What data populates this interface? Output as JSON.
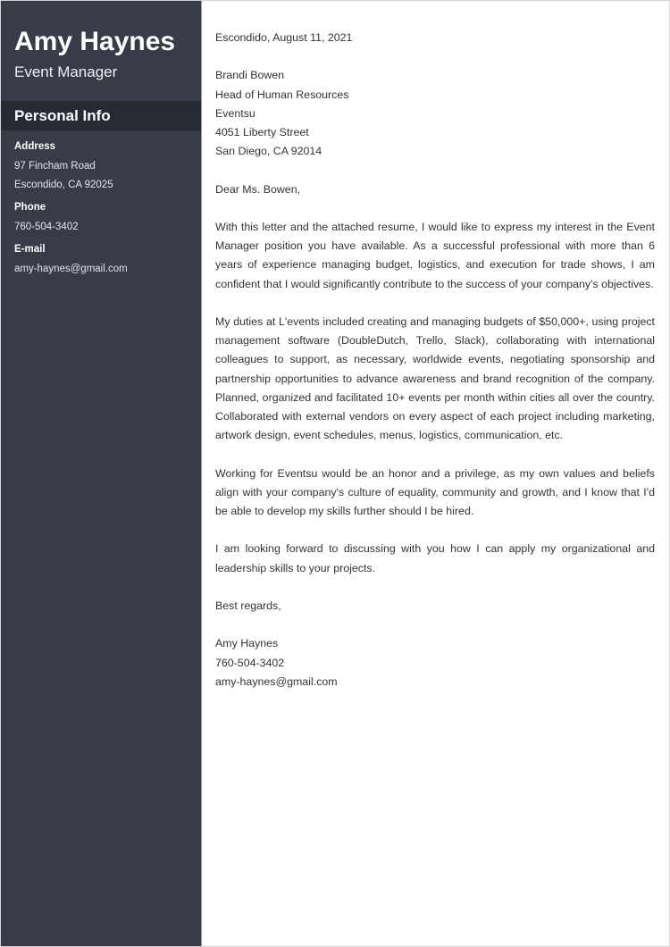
{
  "sidebar": {
    "name": "Amy Haynes",
    "role": "Event Manager",
    "section_title": "Personal Info",
    "address_label": "Address",
    "address_line1": "97 Fincham Road",
    "address_line2": "Escondido, CA 92025",
    "phone_label": "Phone",
    "phone": "760-504-3402",
    "email_label": "E-mail",
    "email": "amy-haynes@gmail.com"
  },
  "letter": {
    "date": "Escondido, August 11, 2021",
    "recipient": {
      "name": "Brandi Bowen",
      "title": "Head of Human Resources",
      "company": "Eventsu",
      "street": "4051 Liberty Street",
      "city": "San Diego, CA 92014"
    },
    "salutation": "Dear Ms. Bowen,",
    "paragraphs": [
      "With this letter and the attached resume, I would like to express my interest in the Event Manager position you have available. As a successful professional with more than 6 years of experience managing budget, logistics, and execution for trade shows, I am confident that I would significantly contribute to the success of your company's objectives.",
      "My duties at L'events included creating and managing budgets of $50,000+, using project management software (DoubleDutch, Trello, Slack), collaborating with international colleagues to support, as necessary, worldwide events, negotiating sponsorship and partnership opportunities to advance awareness and brand recognition of the company. Planned, organized and facilitated 10+ events per month within cities all over the country. Collaborated with external vendors on every aspect of each project including marketing, artwork design, event schedules, menus, logistics, communication, etc.",
      "Working for Eventsu would be an honor and a privilege, as my own values and beliefs align with your company's culture of equality, community and growth, and I know that I'd be able to develop my skills further should I be hired.",
      "I am looking forward to discussing with you how I can apply my organizational and leadership skills to your projects."
    ],
    "closing": "Best regards,",
    "signature": {
      "name": "Amy Haynes",
      "phone": "760-504-3402",
      "email": "amy-haynes@gmail.com"
    }
  }
}
